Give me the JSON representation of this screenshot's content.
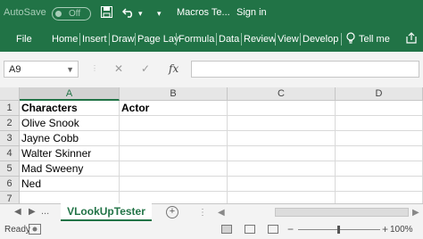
{
  "titlebar": {
    "autosave_label": "AutoSave",
    "autosave_state": "Off",
    "doc_title": "Macros Te...",
    "signin": "Sign in",
    "icons": [
      "save-icon",
      "undo-icon",
      "undo-dropdown-icon",
      "customize-qat-icon"
    ]
  },
  "ribbon": {
    "tabs": [
      "File",
      "Home",
      "Insert",
      "Draw",
      "Page Lay",
      "Formula",
      "Data",
      "Review",
      "View",
      "Develop"
    ],
    "tell_me": "Tell me",
    "share_icon": "share-icon"
  },
  "formula_bar": {
    "name_box": "A9",
    "cancel_symbol": "✕",
    "enter_symbol": "✓",
    "fx_symbol": "fx",
    "formula": ""
  },
  "grid": {
    "columns": [
      "A",
      "B",
      "C",
      "D"
    ],
    "selected_column": "A",
    "rows": [
      {
        "num": "1",
        "A": "Characters",
        "B": "Actor",
        "C": "",
        "D": ""
      },
      {
        "num": "2",
        "A": "Olive Snook",
        "B": "",
        "C": "",
        "D": ""
      },
      {
        "num": "3",
        "A": "Jayne Cobb",
        "B": "",
        "C": "",
        "D": ""
      },
      {
        "num": "4",
        "A": "Walter Skinner",
        "B": "",
        "C": "",
        "D": ""
      },
      {
        "num": "5",
        "A": "Mad Sweeny",
        "B": "",
        "C": "",
        "D": ""
      },
      {
        "num": "6",
        "A": "Ned",
        "B": "",
        "C": "",
        "D": ""
      },
      {
        "num": "7",
        "A": "",
        "B": "",
        "C": "",
        "D": ""
      }
    ]
  },
  "sheets": {
    "ellipsis": "...",
    "active_sheet": "VLookUpTester",
    "add_symbol": "+"
  },
  "status": {
    "ready": "Ready",
    "zoom_minus": "−",
    "zoom_plus": "+",
    "zoom": "100%"
  },
  "colors": {
    "excel_green": "#217346",
    "chrome_gray": "#f3f3f3"
  }
}
